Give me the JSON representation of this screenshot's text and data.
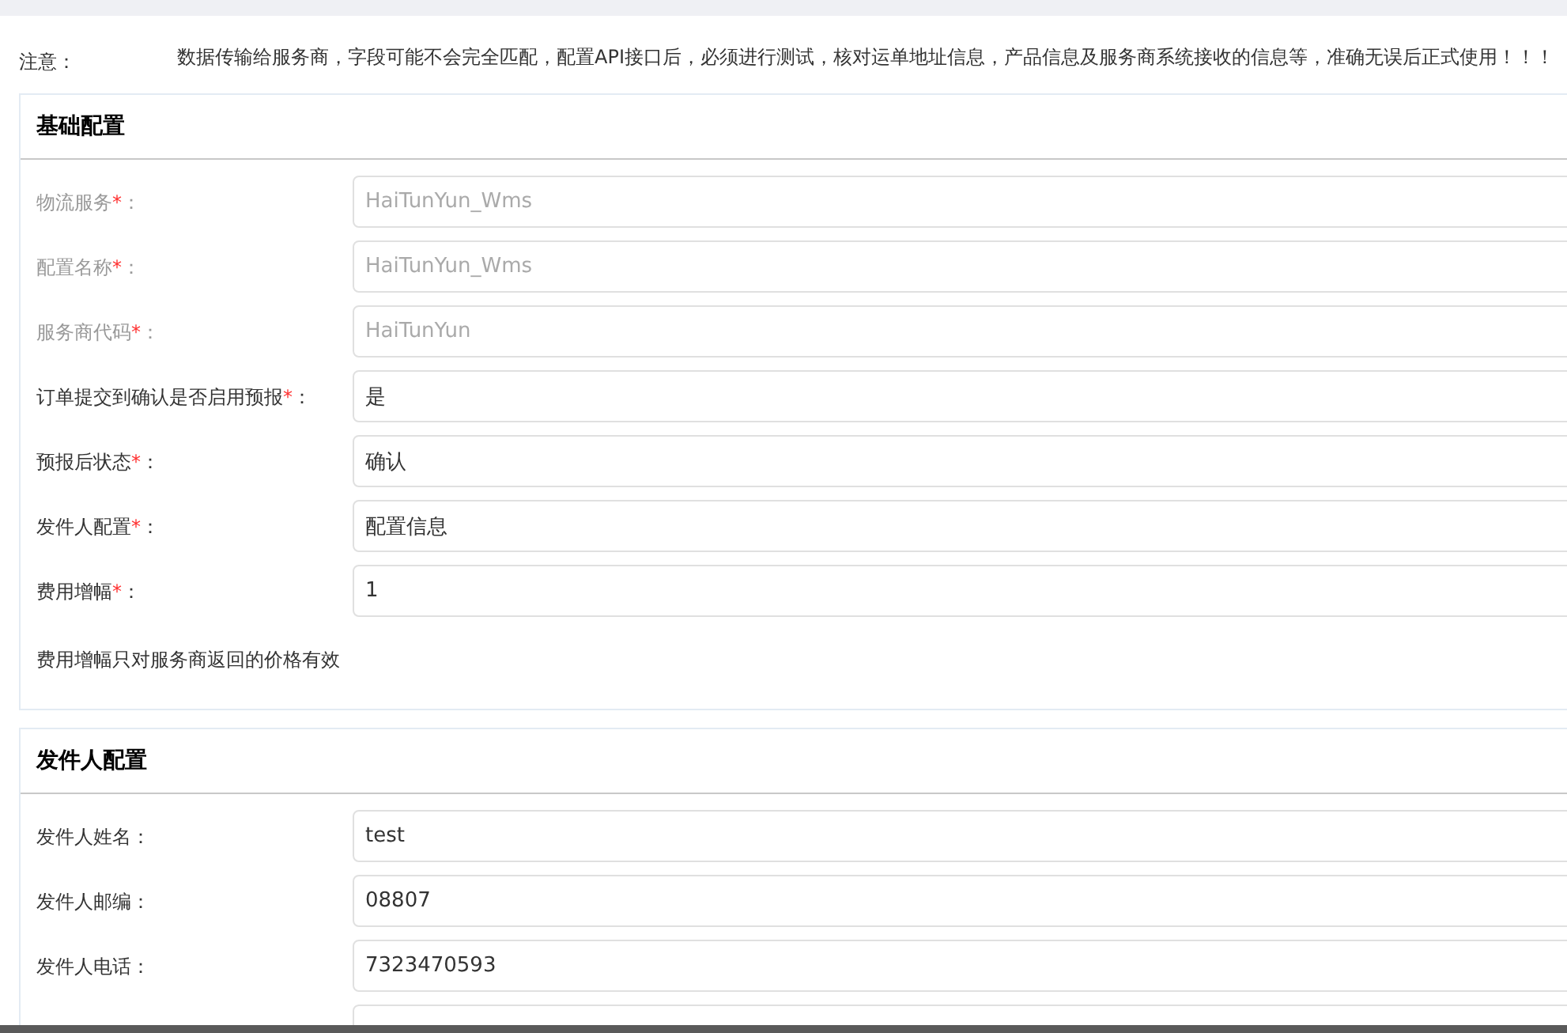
{
  "notice": {
    "label": "注意：",
    "text": "数据传输给服务商，字段可能不会完全匹配，配置API接口后，必须进行测试，核对运单地址信息，产品信息及服务商系统接收的信息等，准确无误后正式使用！！！"
  },
  "required_mark": "*",
  "label_suffix": "：",
  "sections": [
    {
      "title": "基础配置",
      "fields": [
        {
          "kind": "input",
          "label": "物流服务",
          "required": true,
          "disabled": true,
          "value": "HaiTunYun_Wms"
        },
        {
          "kind": "input",
          "label": "配置名称",
          "required": true,
          "disabled": true,
          "value": "HaiTunYun_Wms"
        },
        {
          "kind": "input",
          "label": "服务商代码",
          "required": true,
          "disabled": true,
          "value": "HaiTunYun"
        },
        {
          "kind": "input",
          "label": "订单提交到确认是否启用预报",
          "required": true,
          "disabled": false,
          "value": "是"
        },
        {
          "kind": "input",
          "label": "预报后状态",
          "required": true,
          "disabled": false,
          "value": "确认"
        },
        {
          "kind": "input",
          "label": "发件人配置",
          "required": true,
          "disabled": false,
          "value": "配置信息"
        },
        {
          "kind": "input",
          "label": "费用增幅",
          "required": true,
          "disabled": false,
          "value": "1"
        }
      ],
      "note": "费用增幅只对服务商返回的价格有效"
    },
    {
      "title": "发件人配置",
      "fields": [
        {
          "kind": "input",
          "label": "发件人姓名",
          "disabled": false,
          "value": "test"
        },
        {
          "kind": "input",
          "label": "发件人邮编",
          "disabled": false,
          "value": "08807"
        },
        {
          "kind": "input",
          "label": "发件人电话",
          "disabled": false,
          "value": "7323470593"
        },
        {
          "kind": "input"
        }
      ]
    }
  ]
}
